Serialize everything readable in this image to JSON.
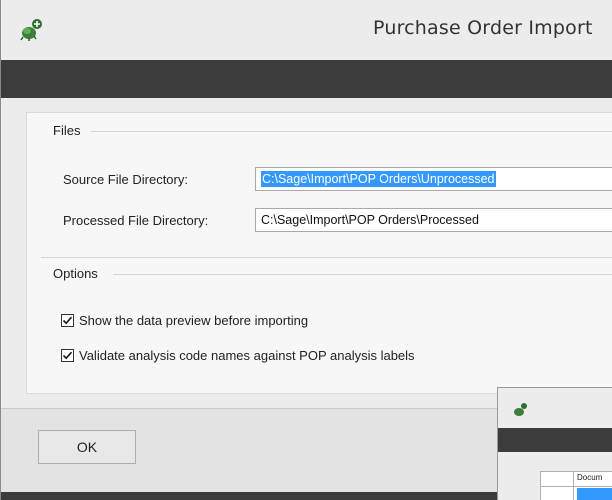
{
  "window": {
    "title": "Purchase Order Import",
    "icon": "sage-add-icon"
  },
  "files_section": {
    "label": "Files",
    "source_label": "Source File Directory:",
    "source_value": "C:\\Sage\\Import\\POP Orders\\Unprocessed",
    "processed_label": "Processed File Directory:",
    "processed_value": "C:\\Sage\\Import\\POP Orders\\Processed"
  },
  "options_section": {
    "label": "Options",
    "show_preview_label": "Show the data preview before importing",
    "show_preview_checked": true,
    "validate_label": "Validate analysis code names against POP analysis labels",
    "validate_checked": true
  },
  "footer": {
    "ok_label": "OK"
  },
  "secondary_window": {
    "grid_header": "Docum"
  },
  "colors": {
    "dark_band": "#3c3c3c",
    "selection": "#3399ff",
    "background": "#ececec"
  }
}
